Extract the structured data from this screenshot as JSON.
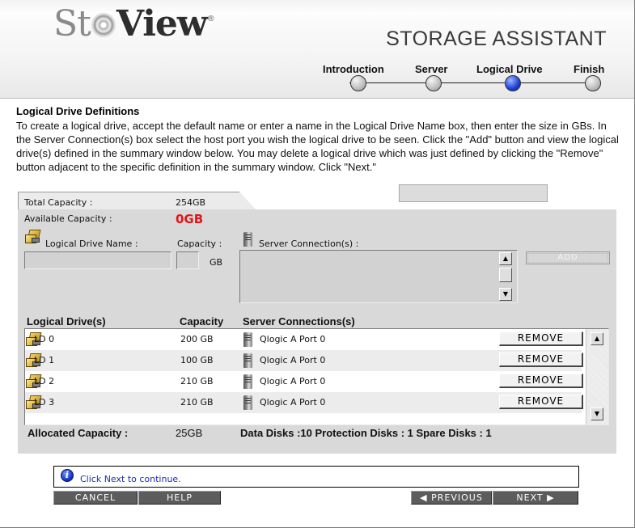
{
  "header": {
    "logo_part1": "St",
    "logo_part2": "View",
    "logo_reg": "®",
    "app_title": "STORAGE ASSISTANT",
    "steps": [
      {
        "label": "Introduction",
        "active": false
      },
      {
        "label": "Server",
        "active": false
      },
      {
        "label": "Logical Drive",
        "active": true
      },
      {
        "label": "Finish",
        "active": false
      }
    ]
  },
  "intro": {
    "title": "Logical Drive Definitions",
    "text": "To create a logical drive, accept the default name or enter a name in the Logical Drive Name box, then enter the size in GBs. In the Server Connection(s) box select the host port you wish the logical drive to be seen. Click the \"Add\" button and view the logical drive(s) defined in the summary window below. You may delete a logical drive which was just defined by clicking the \"Remove\" button adjacent to the specific definition in the summary window. Click \"Next.\""
  },
  "capacity": {
    "total_label": "Total Capacity :",
    "total_value": "254GB",
    "available_label": "Available Capacity :",
    "available_value": "0GB"
  },
  "form": {
    "name_label": "Logical Drive Name :",
    "name_value": "",
    "capacity_label": "Capacity :",
    "capacity_value": "",
    "capacity_unit": "GB",
    "server_label": "Server Connection(s) :",
    "add_label": "ADD"
  },
  "table": {
    "headers": {
      "drive": "Logical Drive(s)",
      "capacity": "Capacity",
      "connections": "Server Connections(s)"
    },
    "remove_label": "REMOVE",
    "rows": [
      {
        "name": "LD 0",
        "capacity": "200 GB",
        "connection": "Qlogic A Port 0"
      },
      {
        "name": "LD 1",
        "capacity": "100 GB",
        "connection": "Qlogic A Port 0"
      },
      {
        "name": "LD 2",
        "capacity": "210 GB",
        "connection": "Qlogic A Port 0"
      },
      {
        "name": "LD 3",
        "capacity": "210 GB",
        "connection": "Qlogic A Port 0"
      }
    ]
  },
  "summary": {
    "allocated_label": "Allocated Capacity :",
    "allocated_value": "25GB",
    "disks_text": "Data Disks :10 Protection Disks : 1  Spare Disks : 1"
  },
  "message": {
    "text": "Click Next to continue."
  },
  "buttons": {
    "cancel": "CANCEL",
    "help": "HELP",
    "previous": "◀ PREVIOUS",
    "next": "NEXT ▶"
  },
  "colors": {
    "accent_blue": "#1d3fd6",
    "alert_red": "#e0161b",
    "panel_gray": "#d9d9d9",
    "button_dark": "#5c5c5c"
  }
}
